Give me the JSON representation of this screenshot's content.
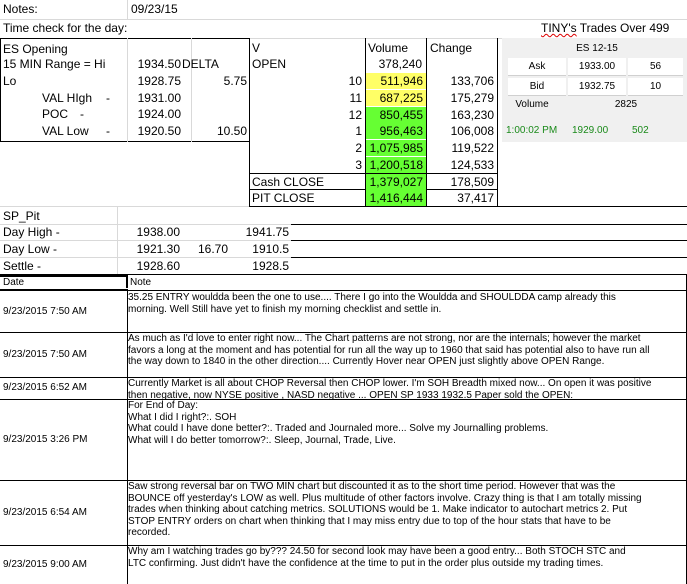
{
  "header": {
    "notes_label": "Notes:",
    "notes_date": "09/23/15",
    "time_check": "Time check for the day:",
    "tinys_title_word": "TINY's",
    "tinys_title_rest": " Trades Over 499"
  },
  "es_opening": {
    "title": "ES Opening",
    "range_label": "15 MIN Range = Hi",
    "range_value": "1934.50",
    "delta_label": "DELTA",
    "lo_label": "Lo",
    "lo_value": "1928.75",
    "delta_value": "5.75",
    "val_high_label": "VAL HIgh",
    "val_high_dash": "-",
    "val_high_value": "1931.00",
    "poc_label": "POC",
    "poc_dash": "-",
    "poc_value": "1924.00",
    "val_low_label": "VAL Low",
    "val_low_dash": "-",
    "val_low_value": "1920.50",
    "val_low_extra": "10.50"
  },
  "volume_table": {
    "col_v": "V",
    "col_volume": "Volume",
    "col_change": "Change",
    "open_label": "OPEN",
    "open_volume": "378,240",
    "rows": [
      {
        "hour": "10",
        "volume": "511,946",
        "change": "133,706",
        "color": "#ffff66"
      },
      {
        "hour": "11",
        "volume": "687,225",
        "change": "175,279",
        "color": "#ffff66"
      },
      {
        "hour": "12",
        "volume": "850,455",
        "change": "163,230",
        "color": "#66ff33"
      },
      {
        "hour": "1",
        "volume": "956,463",
        "change": "106,008",
        "color": "#66ff33"
      },
      {
        "hour": "2",
        "volume": "1,075,985",
        "change": "119,522",
        "color": "#66ff33"
      },
      {
        "hour": "3",
        "volume": "1,200,518",
        "change": "124,533",
        "color": "#66ff33"
      }
    ],
    "cash_close_label": "Cash CLOSE",
    "cash_close_volume": "1,379,027",
    "cash_close_change": "178,509",
    "pit_close_label": "PIT CLOSE",
    "pit_close_volume": "1,416,444",
    "pit_close_change": "37,417"
  },
  "es_quote": {
    "symbol": "ES 12-15",
    "ask_label": "Ask",
    "ask_price": "1933.00",
    "ask_size": "56",
    "bid_label": "Bid",
    "bid_price": "1932.75",
    "bid_size": "10",
    "volume_label": "Volume",
    "volume_value": "2825",
    "last_time": "1:00:02 PM",
    "last_price": "1929.00",
    "last_size": "502",
    "last_color": "#1a8a1a"
  },
  "sp_pit": {
    "title": "SP_Pit",
    "day_high_label": "Day High -",
    "day_high_value": "1938.00",
    "day_high_extra": "1941.75",
    "day_low_label": "Day Low -",
    "day_low_value": "1921.30",
    "day_low_range": "16.70",
    "day_low_extra": "1910.5",
    "settle_label": "Settle -",
    "settle_value": "1928.60",
    "settle_extra": "1928.5"
  },
  "journal": {
    "col_date": "Date",
    "col_note": "Note",
    "entries": [
      {
        "date": "9/23/2015 7:50 AM",
        "lines": [
          "35.25 ENTRY wouldda been the one to use.... There I go into the Wouldda and SHOULDDA camp already this",
          "morning.  Well Still have yet to finish my morning checklist and settle in."
        ]
      },
      {
        "date": "9/23/2015 7:50 AM",
        "lines": [
          "As much as I'd love to enter right now... The Chart patterns are not strong, nor are the internals; however the market",
          "favors a long at the moment and has potential for run all the way up to 1960 that said has potential also to have run all",
          "the way down to 1840 in the other direction.... Currently Hover near OPEN just slightly above OPEN Range."
        ]
      },
      {
        "date": "9/23/2015 6:52 AM",
        "lines": [
          "Currently Market is all about CHOP Reversal then CHOP lower.  I'm SOH Breadth mixed now... On open it was positive",
          "then negative, now NYSE positive , NASD negative ... OPEN SP 1933 1932.5 Paper sold the OPEN:"
        ]
      },
      {
        "date": "9/23/2015 3:26 PM",
        "lines": [
          "For End of Day:",
          "What I did I right?:.  SOH",
          "What could I have done better?:.  Traded and Journaled more... Solve my Journalling problems.",
          "What will I do better tomorrow?:.  Sleep, Journal, Trade, Live."
        ]
      },
      {
        "date": "9/23/2015 6:54 AM",
        "lines": [
          "Saw strong reversal bar on TWO MIN chart but discounted it as to the short time period.  However that was the",
          "BOUNCE off yesterday's LOW as well.  Plus multitude of other factors involve.  Crazy thing is that I am totally missing",
          "trades when thinking about catching metrics.  SOLUTIONS would be 1. Make indicator to autochart metrics 2. Put",
          "STOP ENTRY orders on chart when thinking that I may miss entry due to top of the hour stats that have to be",
          "recorded."
        ]
      },
      {
        "date": "9/23/2015 9:00 AM",
        "lines": [
          "Why am I watching trades go by???  24.50 for second look may have been a good entry... Both STOCH STC and",
          "LTC confirming.  Just didn't have the confidence at the time to put in the order plus outside my trading times."
        ]
      }
    ]
  }
}
